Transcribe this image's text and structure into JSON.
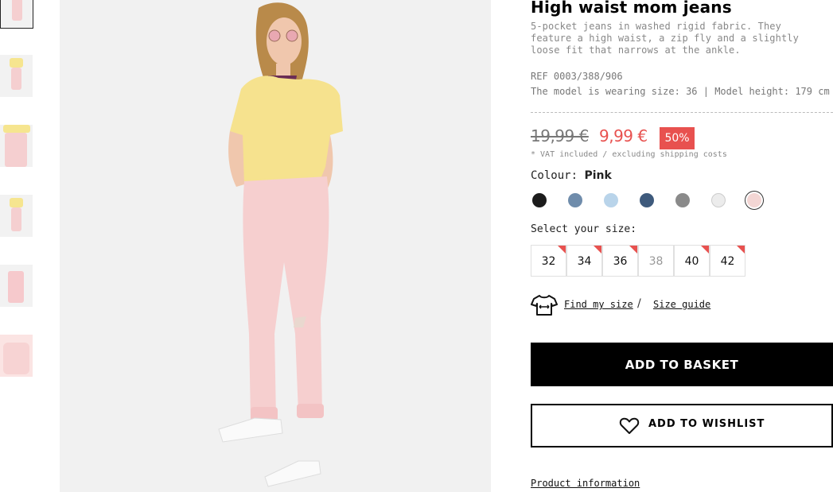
{
  "thumbnails": [
    {
      "label": "thumbnail-1"
    },
    {
      "label": "thumbnail-2"
    },
    {
      "label": "thumbnail-3"
    },
    {
      "label": "thumbnail-4"
    },
    {
      "label": "thumbnail-5"
    },
    {
      "label": "thumbnail-6"
    }
  ],
  "product": {
    "title": "High waist mom jeans",
    "description": "5-pocket jeans in washed rigid fabric. They feature a high waist, a zip fly and a slightly loose fit that narrows at the ankle.",
    "ref": "REF 0003/388/906",
    "model_info": "The model is wearing size: 36 | Model height: 179 cm"
  },
  "price": {
    "old": "19,99 €",
    "new": "9,99 €",
    "discount": "50%",
    "vat_note": "* VAT included / excluding shipping costs"
  },
  "colour": {
    "label": "Colour:",
    "selected": "Pink",
    "swatches": [
      "#1c1c1c",
      "#6f8cab",
      "#b9d4ea",
      "#3e5a7c",
      "#8a8a8a",
      "#ececec",
      "#f3d6d4"
    ]
  },
  "size": {
    "label": "Select your size:",
    "options": [
      "32",
      "34",
      "36",
      "38",
      "40",
      "42"
    ]
  },
  "help": {
    "find_size": "Find my size",
    "separator": "/",
    "size_guide": "Size guide"
  },
  "actions": {
    "add_to_basket": "ADD TO BASKET",
    "add_to_wishlist": "ADD TO WISHLIST"
  },
  "footer": {
    "product_information": "Product information"
  },
  "colors": {
    "accent_red": "#e8514f",
    "black": "#000000"
  }
}
